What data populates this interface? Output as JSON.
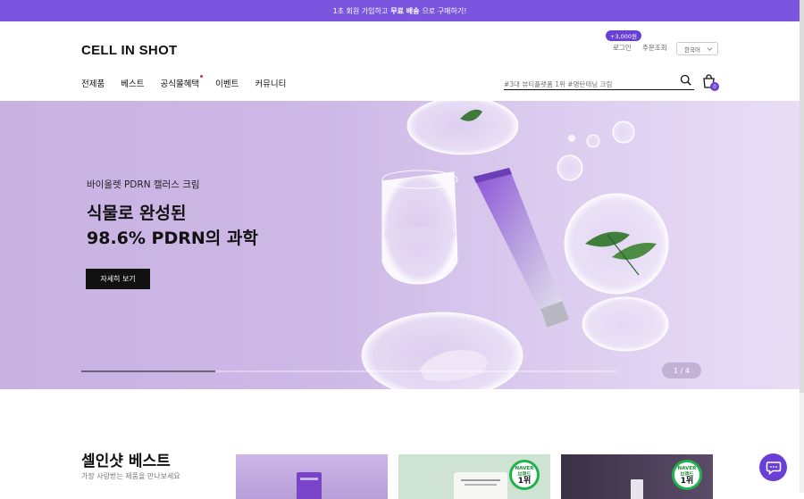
{
  "promo": {
    "prefix": "1초 회원 가입하고",
    "highlight": "무료 배송",
    "suffix": "으로 구매하기!"
  },
  "header": {
    "logo": "CELL IN SHOT",
    "points_badge": "+3,000원",
    "login": "로그인",
    "orders": "주문조회",
    "language": "한국어",
    "nav": [
      "전제품",
      "베스트",
      "공식몰혜택",
      "이벤트",
      "커뮤니티"
    ],
    "search_placeholder": "#3대 뷰티플랫폼 1위 #명탄태닝 크림",
    "cart_count": "0"
  },
  "hero": {
    "subtitle": "바이올렛 PDRN 캘러스 크림",
    "title_line1": "식물로 완성된",
    "title_line2": "98.6% PDRN의 과학",
    "button": "자세히 보기",
    "pager": "1 / 4",
    "progress": 0.25
  },
  "best": {
    "title": "셀인샷 베스트",
    "subtitle": "가장 사랑받는 제품을 만나보세요",
    "badge_top": "NAVER",
    "badge_mid": "브랜드",
    "badge_rank": "1위"
  },
  "colors": {
    "brand": "#7b55e0",
    "accent": "#6a3fd6",
    "badge_green": "#1fb34a"
  },
  "icons": [
    "search-icon",
    "cart-icon",
    "chevron-down-icon",
    "chat-icon"
  ]
}
